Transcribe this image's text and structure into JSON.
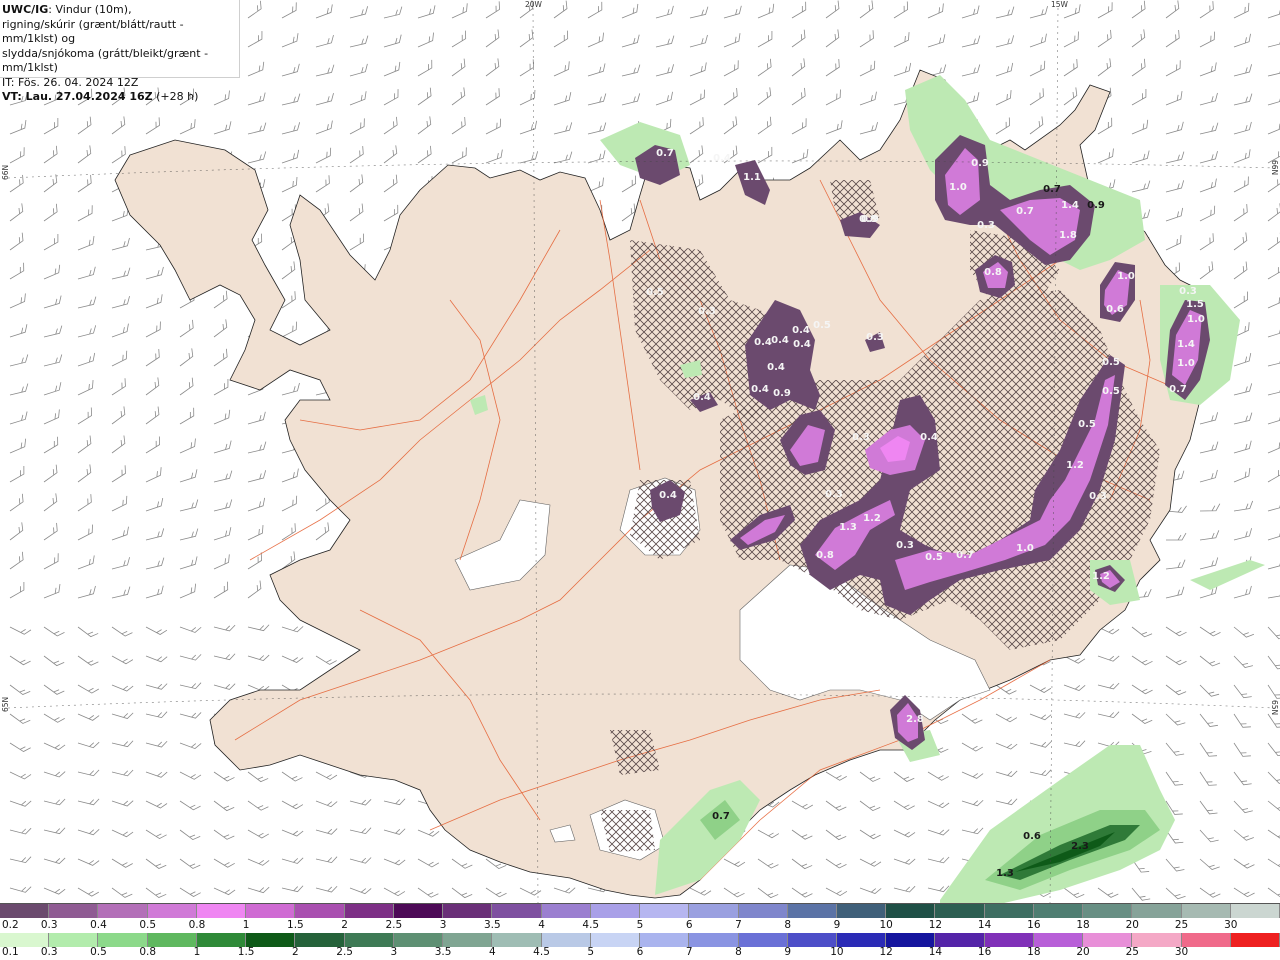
{
  "header": {
    "model": "UWC/IG",
    "title_rest": ": Vindur (10m),",
    "line2": "rigning/skúrir (grænt/blátt/rautt - mm/1klst) og",
    "line3": "slydda/snjókoma (grátt/bleikt/grænt - mm/1klst)",
    "init_time": "IT: Fös. 26. 04. 2024 12Z",
    "valid_label": "VT: Lau. 27.04.2024 16Z",
    "lead": "(+28 h)"
  },
  "graticule": {
    "top_labels": [
      "20W",
      "15W"
    ],
    "left_labels": [
      "66N",
      "65N"
    ],
    "right_labels": [
      "66N",
      "65N"
    ]
  },
  "snow_labels": [
    {
      "text": "0.7"
    },
    {
      "text": "0.4"
    },
    {
      "text": "1.1"
    },
    {
      "text": "0.5"
    },
    {
      "text": "0.3"
    },
    {
      "text": "0.8"
    },
    {
      "text": "0.9"
    },
    {
      "text": "1.0"
    },
    {
      "text": "1.4"
    },
    {
      "text": "1.8"
    },
    {
      "text": "0.7"
    },
    {
      "text": "1.0"
    },
    {
      "text": "0.6"
    },
    {
      "text": "1.0"
    },
    {
      "text": "1.5"
    },
    {
      "text": "1.4"
    },
    {
      "text": "1.0"
    },
    {
      "text": "0.7"
    },
    {
      "text": "0.5"
    },
    {
      "text": "0.5"
    },
    {
      "text": "0.8"
    },
    {
      "text": "0.5"
    },
    {
      "text": "1.2"
    },
    {
      "text": "0.3"
    },
    {
      "text": "0.4"
    },
    {
      "text": "0.4"
    },
    {
      "text": "0.4"
    },
    {
      "text": "0.4"
    },
    {
      "text": "0.5"
    },
    {
      "text": "0.4"
    },
    {
      "text": "0.9"
    },
    {
      "text": "0.3"
    },
    {
      "text": "0.4"
    },
    {
      "text": "0.9"
    },
    {
      "text": "0.4"
    },
    {
      "text": "0.4"
    },
    {
      "text": "0.3"
    },
    {
      "text": "1.3"
    },
    {
      "text": "1.2"
    },
    {
      "text": "0.8"
    },
    {
      "text": "0.3"
    },
    {
      "text": "0.5"
    },
    {
      "text": "0.7"
    },
    {
      "text": "1.0"
    },
    {
      "text": "1.2"
    },
    {
      "text": "0.3"
    },
    {
      "text": "0.4"
    },
    {
      "text": "2.8"
    },
    {
      "text": "0.3"
    },
    {
      "text": "0.3"
    }
  ],
  "rain_labels": [
    {
      "text": "0.7"
    },
    {
      "text": "0.6"
    },
    {
      "text": "2.3"
    },
    {
      "text": "1.3"
    },
    {
      "text": "0.7"
    },
    {
      "text": "0.9"
    }
  ],
  "legend_snow": {
    "labels": [
      "0.2",
      "0.3",
      "0.4",
      "0.5",
      "0.8",
      "1",
      "1.5",
      "2",
      "2.5",
      "3",
      "3.5",
      "4",
      "4.5",
      "5",
      "6",
      "7",
      "8",
      "9",
      "10",
      "12",
      "14",
      "16",
      "18",
      "20",
      "25",
      "30"
    ],
    "colors": [
      "#6b4a6e",
      "#8f5b93",
      "#b36fb8",
      "#d07ad7",
      "#ef86f2",
      "#cf6bd3",
      "#a94fb0",
      "#7d2f86",
      "#4d0a57",
      "#6a2f78",
      "#7e50a0",
      "#9b7fd0",
      "#a9a0e8",
      "#b6b6f0",
      "#9aa0e0",
      "#7f86cc",
      "#5b73a6",
      "#40607a",
      "#1f5046",
      "#2d5f52",
      "#3e6e62",
      "#4f7e72",
      "#688f84",
      "#86a399",
      "#a6bab2",
      "#cbd6d1"
    ]
  },
  "legend_rain": {
    "labels": [
      "0.1",
      "0.3",
      "0.5",
      "0.8",
      "1",
      "1.5",
      "2",
      "2.5",
      "3",
      "3.5",
      "4",
      "4.5",
      "5",
      "6",
      "7",
      "8",
      "9",
      "10",
      "12",
      "14",
      "16",
      "18",
      "20",
      "25",
      "30"
    ],
    "colors": [
      "#d9f7cf",
      "#b2ecac",
      "#8cd98a",
      "#5fb85f",
      "#2f8a38",
      "#0e5a18",
      "#25623a",
      "#3e7a55",
      "#5e9073",
      "#7fa592",
      "#9fbdb4",
      "#b9c9e6",
      "#c8d4f4",
      "#aab4ee",
      "#8a94e2",
      "#6a70d6",
      "#4d4ec8",
      "#2b2bb6",
      "#15159e",
      "#5424a8",
      "#8030b8",
      "#b85fd8",
      "#e88fd8",
      "#f4a8c6",
      "#f06a8a",
      "#ee2020"
    ]
  }
}
